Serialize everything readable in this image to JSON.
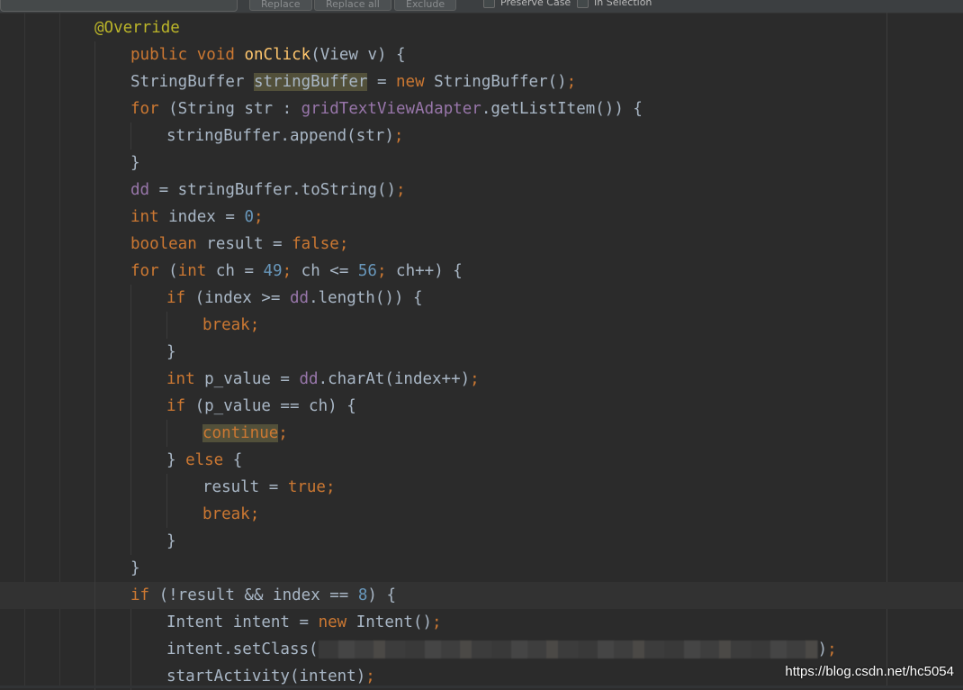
{
  "toolbar": {
    "buttons": [
      "Replace",
      "Replace all",
      "Exclude"
    ],
    "checkboxes": [
      {
        "label": "Preserve Case",
        "checked": false
      },
      {
        "label": "In Selection",
        "checked": false
      }
    ]
  },
  "code_lines": [
    {
      "segments": [
        {
          "t": "@Override",
          "c": "ann"
        }
      ]
    },
    {
      "segments": [
        {
          "t": "public",
          "c": "kw"
        },
        {
          "t": " "
        },
        {
          "t": "void",
          "c": "kw"
        },
        {
          "t": " "
        },
        {
          "t": "onClick",
          "c": "fn"
        },
        {
          "t": "(View v) {"
        }
      ]
    },
    {
      "segments": [
        {
          "t": "StringBuffer "
        },
        {
          "t": "stringBuffer",
          "c": "hl2"
        },
        {
          "t": " = "
        },
        {
          "t": "new",
          "c": "kw"
        },
        {
          "t": " StringBuffer()"
        },
        {
          "t": ";",
          "c": "kw"
        }
      ]
    },
    {
      "segments": [
        {
          "t": "for",
          "c": "kw"
        },
        {
          "t": " (String str : "
        },
        {
          "t": "gridTextViewAdapter",
          "c": "fld"
        },
        {
          "t": ".getListItem()) {"
        }
      ]
    },
    {
      "segments": [
        {
          "t": "stringBuffer.append(str)"
        },
        {
          "t": ";",
          "c": "kw"
        }
      ]
    },
    {
      "segments": [
        {
          "t": "}"
        }
      ]
    },
    {
      "segments": [
        {
          "t": "dd",
          "c": "fld"
        },
        {
          "t": " = stringBuffer.toString()"
        },
        {
          "t": ";",
          "c": "kw"
        }
      ]
    },
    {
      "segments": [
        {
          "t": "int",
          "c": "kw"
        },
        {
          "t": " index = "
        },
        {
          "t": "0",
          "c": "num"
        },
        {
          "t": ";",
          "c": "kw"
        }
      ]
    },
    {
      "segments": [
        {
          "t": "boolean",
          "c": "kw"
        },
        {
          "t": " result = "
        },
        {
          "t": "false",
          "c": "kw"
        },
        {
          "t": ";",
          "c": "kw"
        }
      ]
    },
    {
      "segments": [
        {
          "t": "for",
          "c": "kw"
        },
        {
          "t": " ("
        },
        {
          "t": "int",
          "c": "kw"
        },
        {
          "t": " ch = "
        },
        {
          "t": "49",
          "c": "num"
        },
        {
          "t": "; ",
          "c": "kw"
        },
        {
          "t": "ch <= "
        },
        {
          "t": "56",
          "c": "num"
        },
        {
          "t": "; ",
          "c": "kw"
        },
        {
          "t": "ch++) {"
        }
      ]
    },
    {
      "segments": [
        {
          "t": "if",
          "c": "kw"
        },
        {
          "t": " (index >= "
        },
        {
          "t": "dd",
          "c": "fld"
        },
        {
          "t": ".length()) {"
        }
      ]
    },
    {
      "segments": [
        {
          "t": "break",
          "c": "kw"
        },
        {
          "t": ";",
          "c": "kw"
        }
      ]
    },
    {
      "segments": [
        {
          "t": "}"
        }
      ]
    },
    {
      "segments": [
        {
          "t": "int",
          "c": "kw"
        },
        {
          "t": " p_value = "
        },
        {
          "t": "dd",
          "c": "fld"
        },
        {
          "t": ".charAt(index++)"
        },
        {
          "t": ";",
          "c": "kw"
        }
      ]
    },
    {
      "segments": [
        {
          "t": "if",
          "c": "kw"
        },
        {
          "t": " (p_value == ch) {"
        }
      ]
    },
    {
      "segments": [
        {
          "t": "continue",
          "c": "kw hl2"
        },
        {
          "t": ";",
          "c": "kw"
        }
      ]
    },
    {
      "segments": [
        {
          "t": "} "
        },
        {
          "t": "else",
          "c": "kw"
        },
        {
          "t": " {"
        }
      ]
    },
    {
      "segments": [
        {
          "t": "result = "
        },
        {
          "t": "true",
          "c": "kw"
        },
        {
          "t": ";",
          "c": "kw"
        }
      ]
    },
    {
      "segments": [
        {
          "t": "break",
          "c": "kw"
        },
        {
          "t": ";",
          "c": "kw"
        }
      ]
    },
    {
      "segments": [
        {
          "t": "}"
        }
      ]
    },
    {
      "segments": [
        {
          "t": "}"
        }
      ]
    },
    {
      "segments": [
        {
          "t": "if",
          "c": "kw"
        },
        {
          "t": " (!result && index == "
        },
        {
          "t": "8",
          "c": "num"
        },
        {
          "t": ") {"
        }
      ],
      "current": true
    },
    {
      "segments": [
        {
          "t": "Intent intent = "
        },
        {
          "t": "new",
          "c": "kw"
        },
        {
          "t": " Intent()"
        },
        {
          "t": ";",
          "c": "kw"
        }
      ]
    },
    {
      "segments": [
        {
          "t": "intent.setClass("
        },
        {
          "redacted": true
        },
        {
          "t": ")"
        },
        {
          "t": ";",
          "c": "kw"
        }
      ]
    },
    {
      "segments": [
        {
          "t": "startActivity(intent)"
        },
        {
          "t": ";",
          "c": "kw"
        }
      ]
    }
  ],
  "watermark": "https://blog.csdn.net/hc5054"
}
